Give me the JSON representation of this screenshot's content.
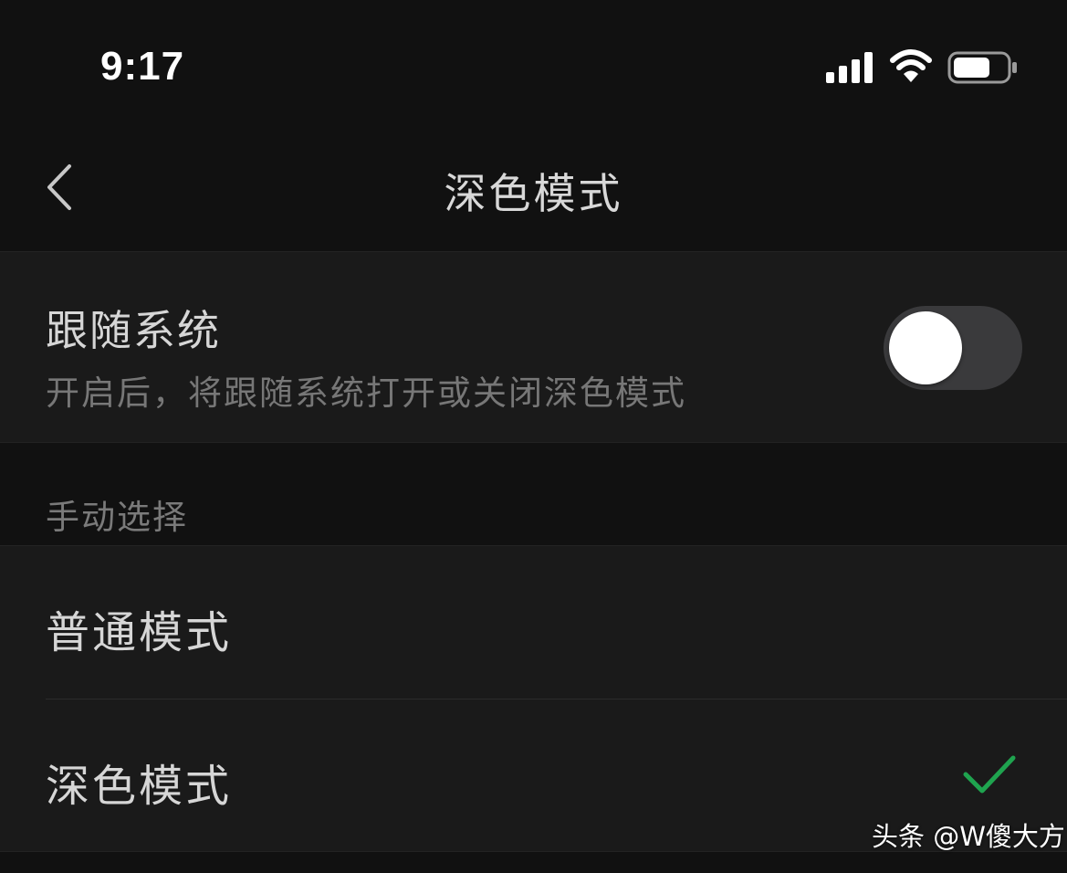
{
  "status_bar": {
    "time": "9:17",
    "icons": [
      "signal-icon",
      "wifi-icon",
      "battery-icon"
    ],
    "battery_level": 0.7
  },
  "nav": {
    "back_icon": "chevron-left-icon",
    "title": "深色模式"
  },
  "follow_system": {
    "title": "跟随系统",
    "description": "开启后，将跟随系统打开或关闭深色模式",
    "toggle_on": false
  },
  "manual": {
    "header": "手动选择",
    "options": [
      {
        "label": "普通模式",
        "selected": false
      },
      {
        "label": "深色模式",
        "selected": true
      }
    ]
  },
  "watermark": {
    "text": "头条 @W傻大方"
  },
  "colors": {
    "background": "#111111",
    "surface": "#1a1a1a",
    "toggle_off": "#3a3a3c",
    "check": "#1fa34f",
    "secondary_text": "#777777"
  }
}
